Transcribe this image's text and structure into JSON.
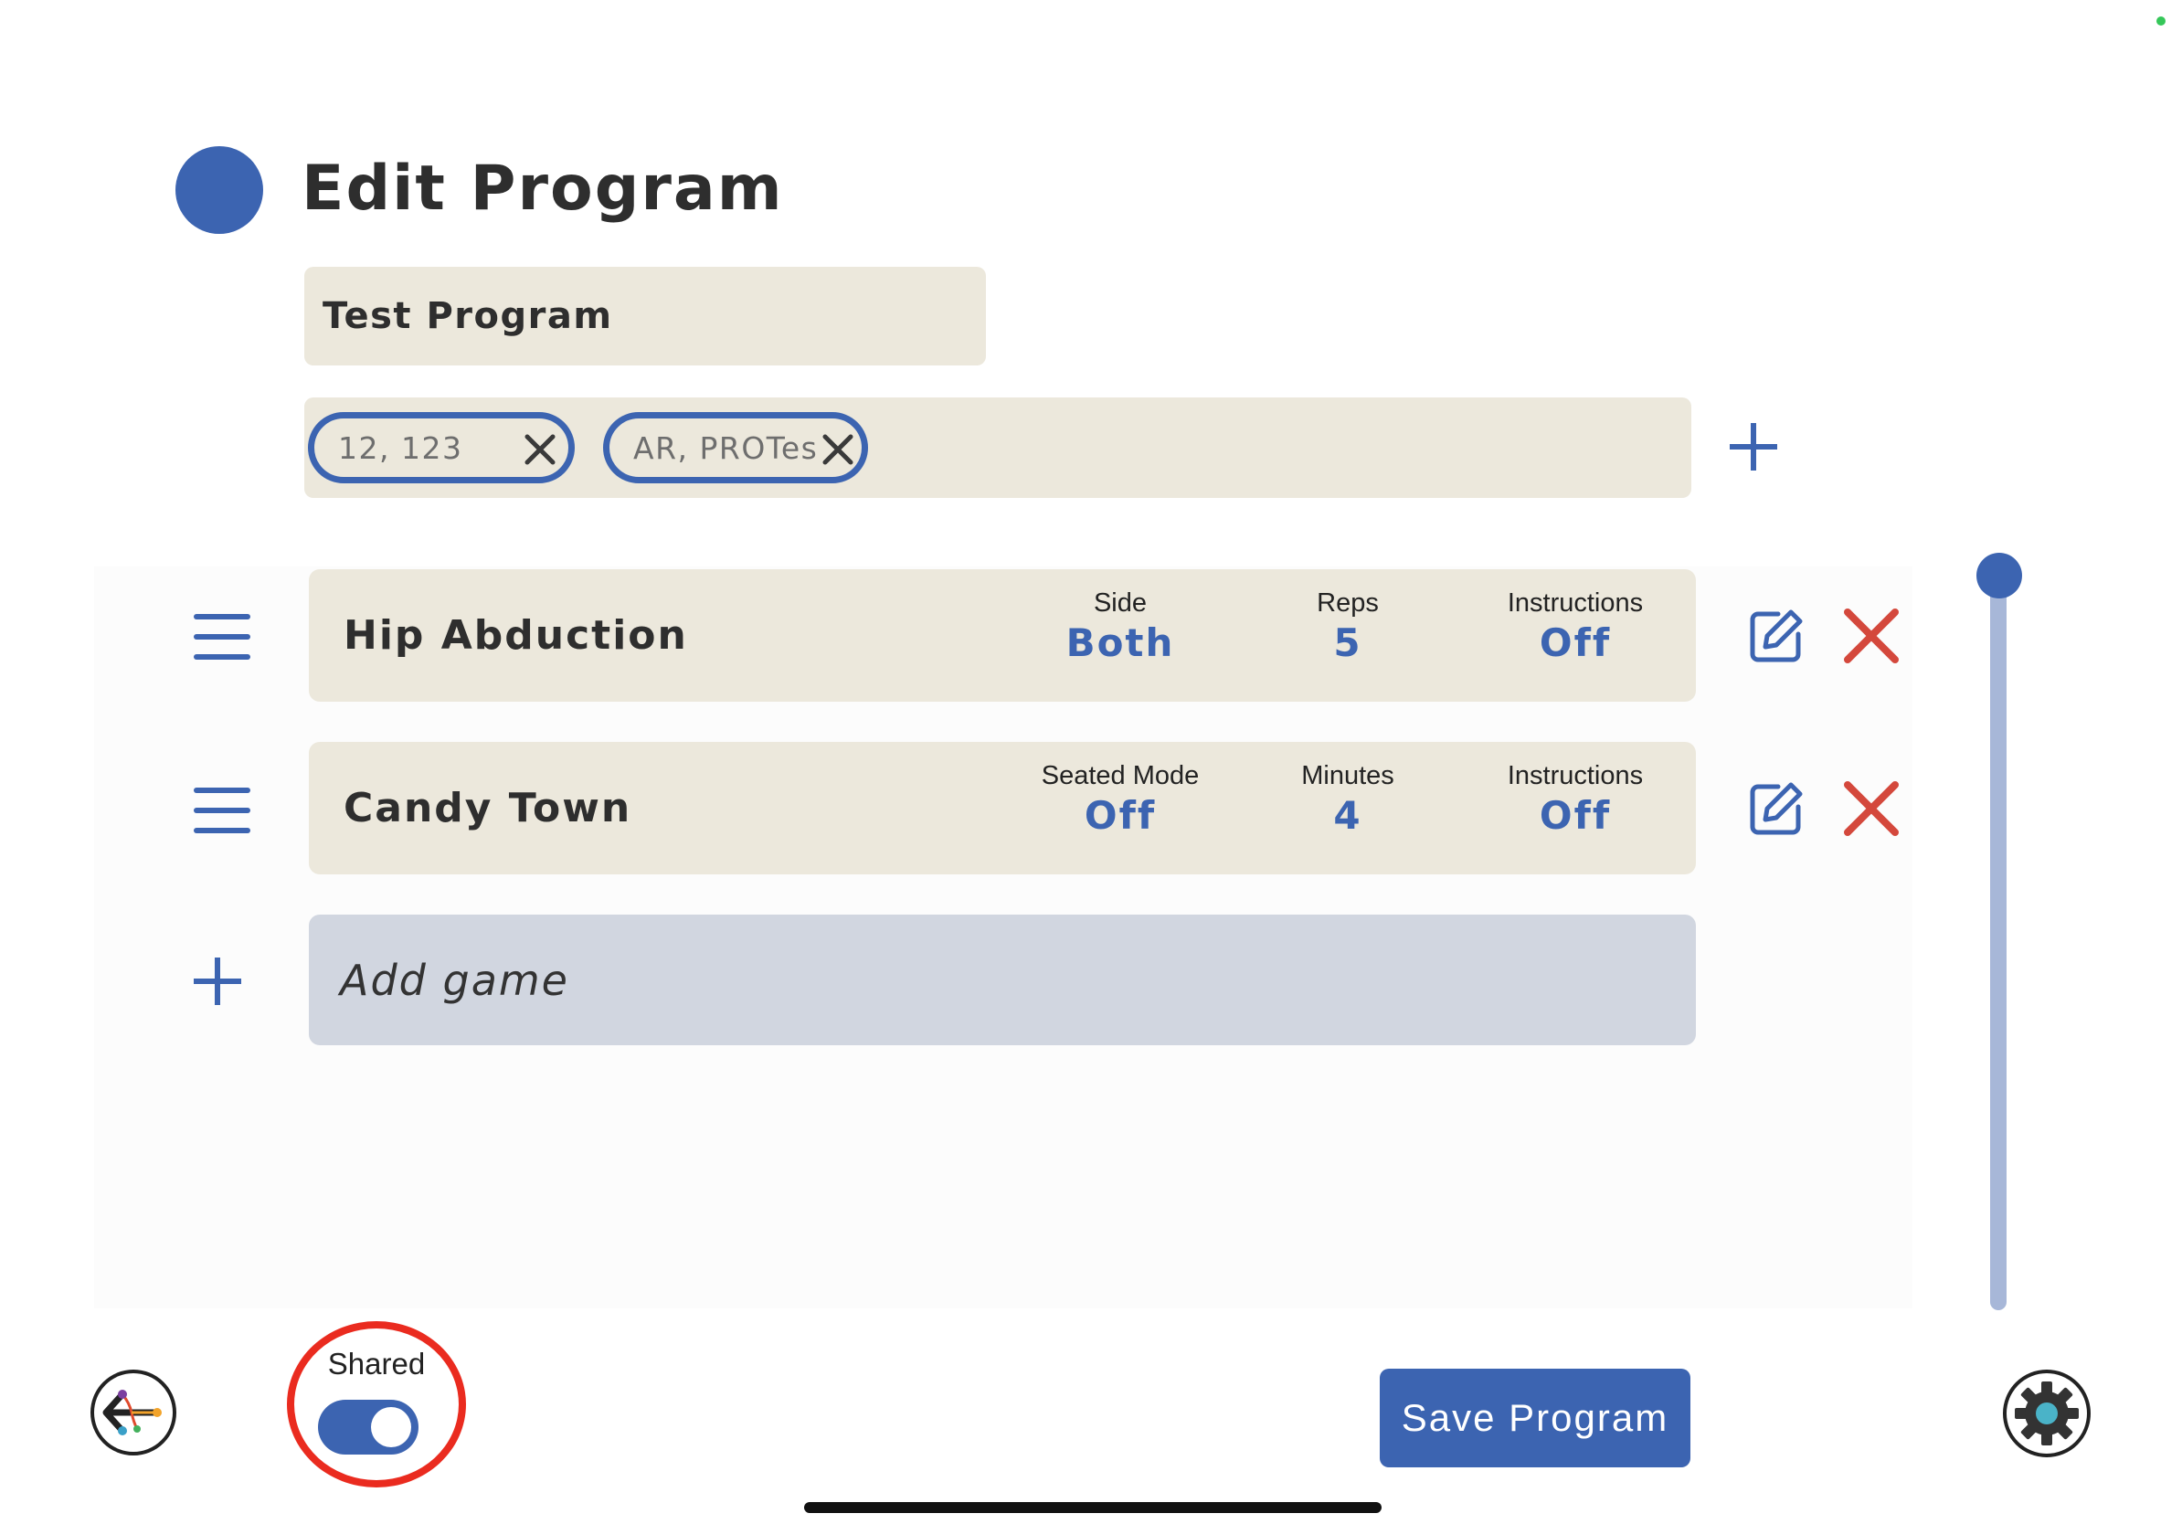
{
  "header": {
    "title": "Edit Program"
  },
  "program": {
    "name": "Test Program"
  },
  "tags": [
    {
      "label": "12, 123"
    },
    {
      "label": "AR, PROTes"
    }
  ],
  "exercises": [
    {
      "name": "Hip Abduction",
      "fields": [
        {
          "label": "Side",
          "value": "Both"
        },
        {
          "label": "Reps",
          "value": "5"
        },
        {
          "label": "Instructions",
          "value": "Off"
        }
      ]
    },
    {
      "name": "Candy Town",
      "fields": [
        {
          "label": "Seated Mode",
          "value": "Off"
        },
        {
          "label": "Minutes",
          "value": "4"
        },
        {
          "label": "Instructions",
          "value": "Off"
        }
      ]
    }
  ],
  "add_game": {
    "placeholder": "Add game"
  },
  "footer": {
    "shared_label": "Shared",
    "shared_on": true,
    "save_label": "Save Program"
  },
  "colors": {
    "accent": "#3c64b1",
    "delete": "#d4483c",
    "field_bg": "#ece8dc",
    "highlight": "#ea2b1f"
  },
  "icons": [
    "back-arrow-icon",
    "gear-icon",
    "hamburger-icon",
    "edit-icon",
    "close-icon",
    "plus-icon"
  ]
}
